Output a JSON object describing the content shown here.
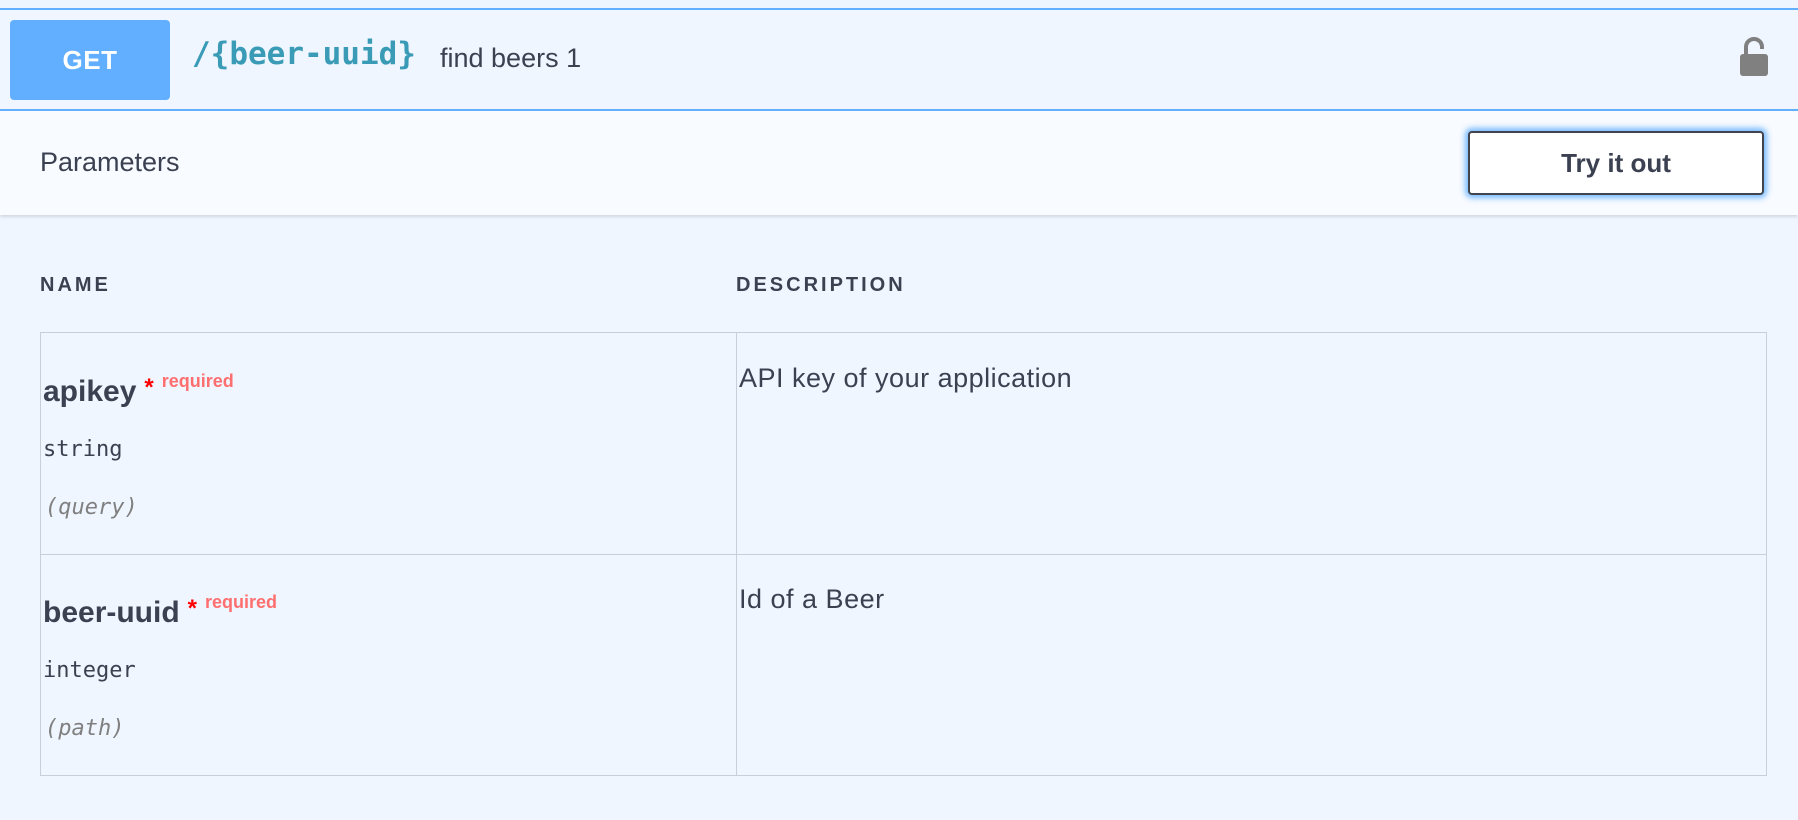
{
  "operation": {
    "method": "GET",
    "path": "/{beer-uuid}",
    "summary": "find beers 1"
  },
  "parameters_section": {
    "title": "Parameters",
    "try_button": "Try it out",
    "columns": {
      "name": "NAME",
      "description": "DESCRIPTION"
    },
    "params": [
      {
        "name": "apikey",
        "required_star": "*",
        "required_label": "required",
        "type": "string",
        "in": "(query)",
        "description": "API key of your application"
      },
      {
        "name": "beer-uuid",
        "required_star": "*",
        "required_label": "required",
        "type": "integer",
        "in": "(path)",
        "description": "Id of a Beer"
      }
    ]
  },
  "icons": {
    "lock": "unlocked-lock-icon"
  },
  "colors": {
    "get_accent": "#61affe",
    "path_text": "#3a9bb6",
    "required": "#ff6f6f"
  }
}
